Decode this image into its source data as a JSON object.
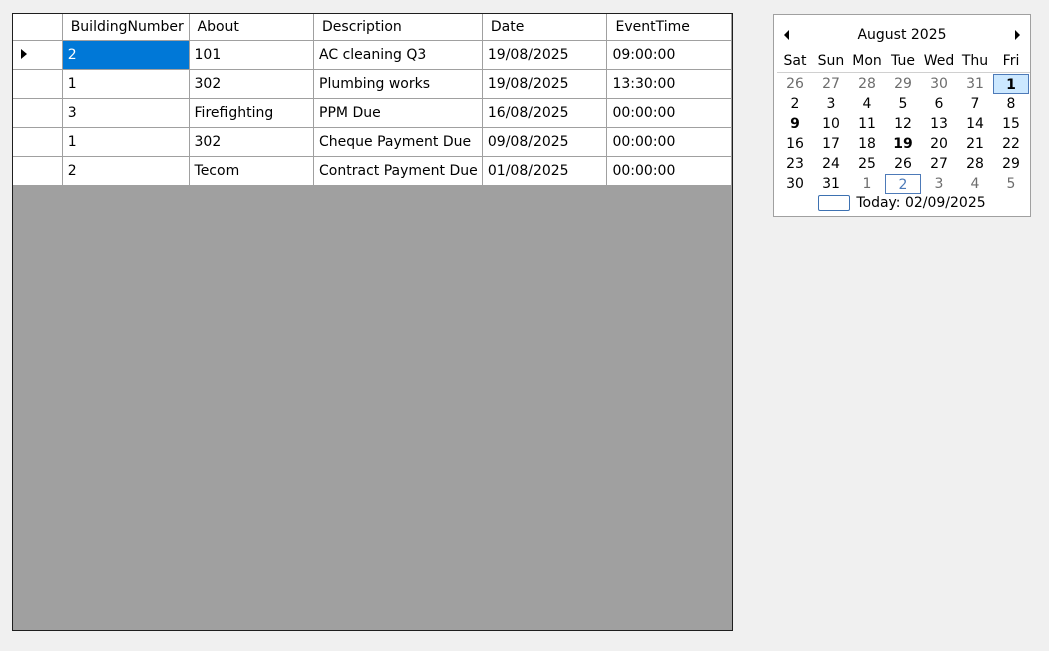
{
  "grid": {
    "columns": [
      "BuildingNumber",
      "About",
      "Description",
      "Date",
      "EventTime"
    ],
    "rows": [
      [
        "2",
        "101",
        "AC cleaning Q3",
        "19/08/2025",
        "09:00:00"
      ],
      [
        "1",
        "302",
        "Plumbing works",
        "19/08/2025",
        "13:30:00"
      ],
      [
        "3",
        "Firefighting",
        "PPM Due",
        "16/08/2025",
        "00:00:00"
      ],
      [
        "1",
        "302",
        "Cheque Payment Due",
        "09/08/2025",
        "00:00:00"
      ],
      [
        "2",
        "Tecom",
        "Contract Payment Due",
        "01/08/2025",
        "00:00:00"
      ]
    ],
    "selected_cell": {
      "row": 0,
      "col": 0
    },
    "colors": {
      "selection": "#0078d7",
      "empty_area": "#a0a0a0"
    }
  },
  "calendar": {
    "title": "August 2025",
    "weekdays": [
      "Sat",
      "Sun",
      "Mon",
      "Tue",
      "Wed",
      "Thu",
      "Fri"
    ],
    "weeks": [
      [
        {
          "d": "26",
          "o": true
        },
        {
          "d": "27",
          "o": true
        },
        {
          "d": "28",
          "o": true
        },
        {
          "d": "29",
          "o": true
        },
        {
          "d": "30",
          "o": true
        },
        {
          "d": "31",
          "o": true
        },
        {
          "d": "1",
          "s": true,
          "b": true
        }
      ],
      [
        {
          "d": "2"
        },
        {
          "d": "3"
        },
        {
          "d": "4"
        },
        {
          "d": "5"
        },
        {
          "d": "6"
        },
        {
          "d": "7"
        },
        {
          "d": "8"
        }
      ],
      [
        {
          "d": "9",
          "b": true
        },
        {
          "d": "10"
        },
        {
          "d": "11"
        },
        {
          "d": "12"
        },
        {
          "d": "13"
        },
        {
          "d": "14"
        },
        {
          "d": "15"
        }
      ],
      [
        {
          "d": "16"
        },
        {
          "d": "17"
        },
        {
          "d": "18"
        },
        {
          "d": "19",
          "b": true
        },
        {
          "d": "20"
        },
        {
          "d": "21"
        },
        {
          "d": "22"
        }
      ],
      [
        {
          "d": "23"
        },
        {
          "d": "24"
        },
        {
          "d": "25"
        },
        {
          "d": "26"
        },
        {
          "d": "27"
        },
        {
          "d": "28"
        },
        {
          "d": "29"
        }
      ],
      [
        {
          "d": "30"
        },
        {
          "d": "31"
        },
        {
          "d": "1",
          "o": true
        },
        {
          "d": "2",
          "o": true,
          "t": true
        },
        {
          "d": "3",
          "o": true
        },
        {
          "d": "4",
          "o": true
        },
        {
          "d": "5",
          "o": true
        }
      ]
    ],
    "today_label": "Today: 02/09/2025"
  }
}
